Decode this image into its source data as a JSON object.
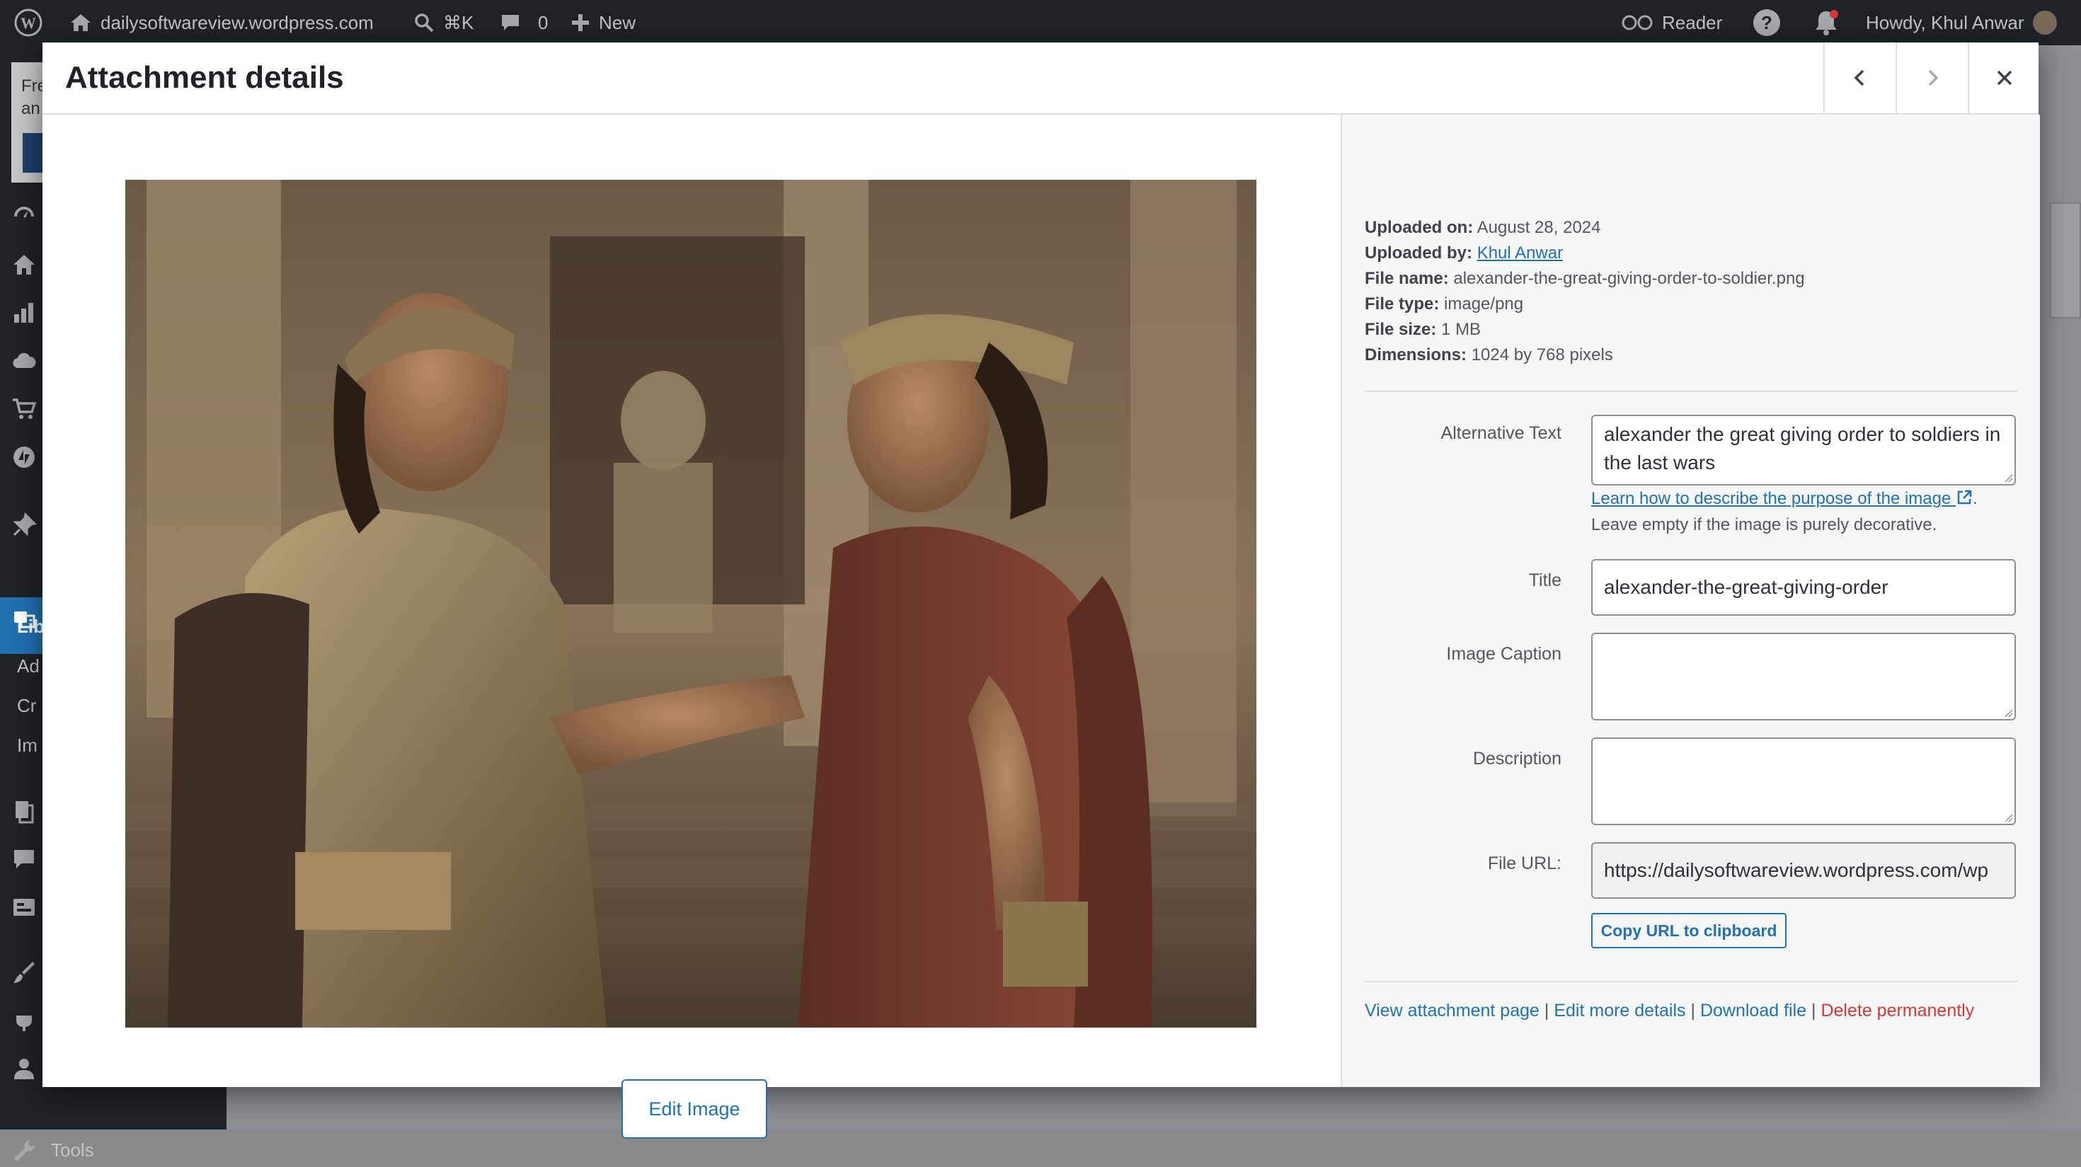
{
  "adminbar": {
    "site_name": "dailysoftwareview.wordpress.com",
    "search_shortcut": "⌘K",
    "comments_count": "0",
    "new_label": "New",
    "reader_label": "Reader",
    "howdy": "Howdy, Khul Anwar"
  },
  "sidebar": {
    "notice_text": [
      "Fre",
      "an"
    ],
    "library_label": "Lib",
    "sub_items": [
      "Ad",
      "Cr",
      "Im"
    ],
    "tools_label": "Tools"
  },
  "modal": {
    "title": "Attachment details",
    "prev_label": "Previous",
    "next_label": "Next",
    "close_label": "Close",
    "edit_image_label": "Edit Image"
  },
  "details": {
    "uploaded_on_label": "Uploaded on:",
    "uploaded_on": "August 28, 2024",
    "uploaded_by_label": "Uploaded by:",
    "uploaded_by": "Khul Anwar",
    "file_name_label": "File name:",
    "file_name": "alexander-the-great-giving-order-to-soldier.png",
    "file_type_label": "File type:",
    "file_type": "image/png",
    "file_size_label": "File size:",
    "file_size": "1 MB",
    "dimensions_label": "Dimensions:",
    "dimensions": "1024 by 768 pixels"
  },
  "form": {
    "alt_label": "Alternative Text",
    "alt_value": "alexander the great giving order to soldiers in the last wars",
    "alt_help_link": "Learn how to describe the purpose of the image",
    "alt_help_suffix": ".",
    "alt_help_text": "Leave empty if the image is purely decorative.",
    "title_label": "Title",
    "title_value": "alexander-the-great-giving-order",
    "caption_label": "Image Caption",
    "caption_value": "",
    "description_label": "Description",
    "description_value": "",
    "url_label": "File URL:",
    "url_value": "https://dailysoftwareview.wordpress.com/wp",
    "copy_label": "Copy URL to clipboard"
  },
  "links": {
    "view": "View attachment page",
    "edit": "Edit more details",
    "download": "Download file",
    "delete": "Delete permanently",
    "sep": "|"
  },
  "colors": {
    "accent": "#2271b1",
    "danger": "#d63638",
    "adminbar": "#1d2327"
  }
}
